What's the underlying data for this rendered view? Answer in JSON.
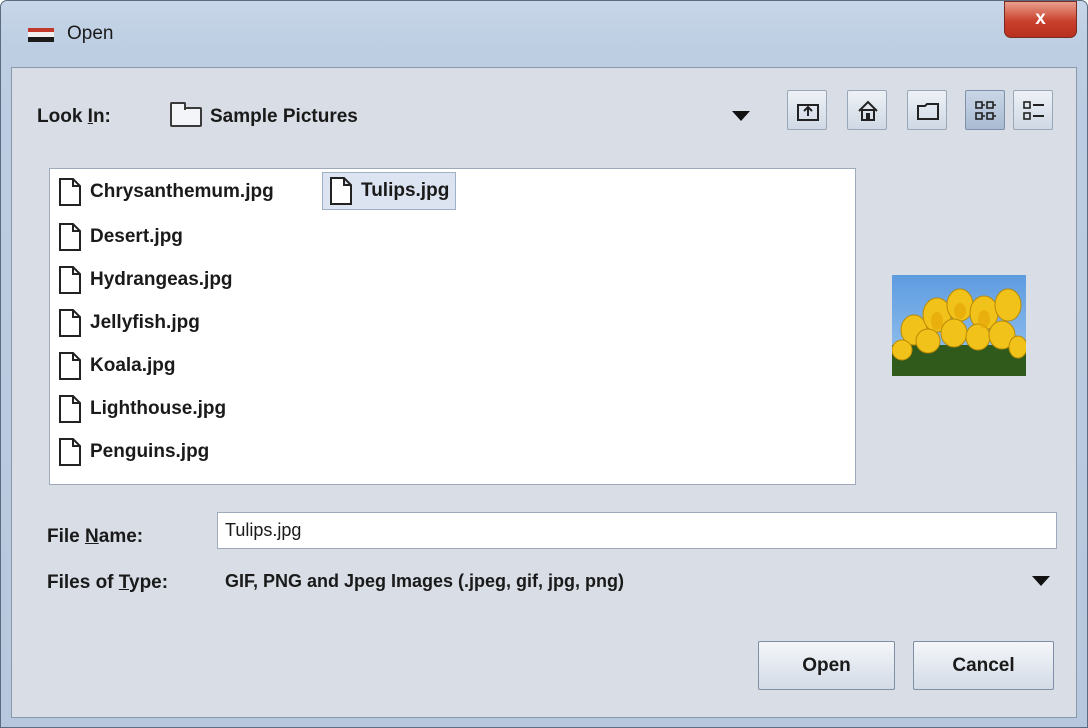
{
  "window": {
    "title": "Open",
    "close_glyph": "x"
  },
  "look_in": {
    "label": "Look In:",
    "label_prefix": "Look ",
    "label_mnemonic": "I",
    "label_suffix": "n:",
    "value": "Sample Pictures",
    "folder_icon": "folder-icon"
  },
  "toolbar": {
    "buttons": [
      {
        "name": "up-one-level-icon"
      },
      {
        "name": "home-icon"
      },
      {
        "name": "new-folder-icon"
      },
      {
        "name": "list-view-icon",
        "active": true
      },
      {
        "name": "details-view-icon"
      }
    ]
  },
  "files": [
    {
      "name": "Chrysanthemum.jpg"
    },
    {
      "name": "Desert.jpg"
    },
    {
      "name": "Hydrangeas.jpg"
    },
    {
      "name": "Jellyfish.jpg"
    },
    {
      "name": "Koala.jpg"
    },
    {
      "name": "Lighthouse.jpg"
    },
    {
      "name": "Penguins.jpg"
    },
    {
      "name": "Tulips.jpg",
      "selected": true
    }
  ],
  "preview": {
    "icon": "tulips-thumbnail"
  },
  "file_name": {
    "label_prefix": "File ",
    "label_mnemonic": "N",
    "label_suffix": "ame:",
    "value": "Tulips.jpg"
  },
  "file_type": {
    "label_prefix": "Files of ",
    "label_mnemonic": "T",
    "label_suffix": "ype:",
    "value": "GIF, PNG and Jpeg Images (.jpeg, gif, jpg, png)"
  },
  "actions": {
    "open_label": "Open",
    "cancel_label": "Cancel"
  },
  "colors": {
    "accent_selection": "#dbe4f0",
    "close_button": "#c9402c"
  }
}
